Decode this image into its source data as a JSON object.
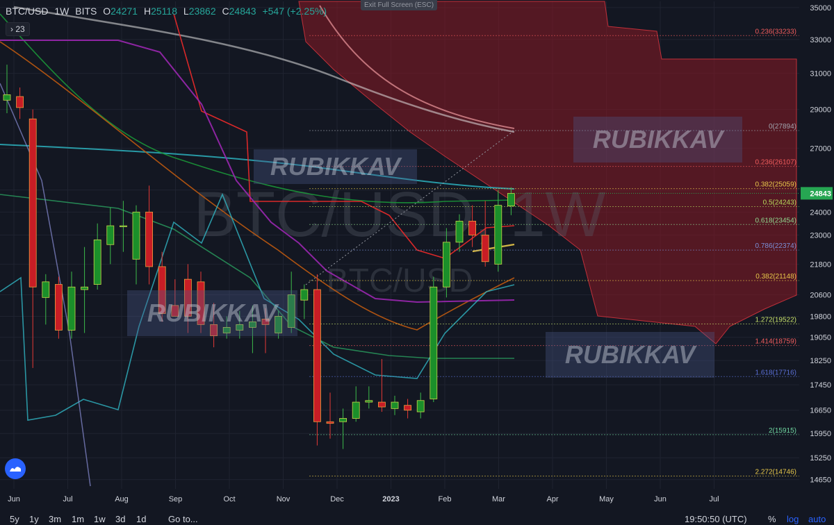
{
  "header": {
    "symbol": "BTC/USD",
    "interval": "1W",
    "exchange": "BITS",
    "open_label": "O",
    "open": "24271",
    "high_label": "H",
    "high": "25118",
    "low_label": "L",
    "low": "23862",
    "close_label": "C",
    "close": "24843",
    "change": "+547 (+2.25%)"
  },
  "indicator_toggle": "› 23",
  "exit_fullscreen": "Exit Full Screen (ESC)",
  "watermark": {
    "main": "BTC/USD, 1W",
    "sub": "BTC/USD"
  },
  "brand_watermark": "RUBIKKAV",
  "colors": {
    "up": "#26a69a",
    "down": "#ef5350",
    "green_body": "#1b8f2a",
    "red_body": "#c81d25",
    "cloud": "#8b1a24",
    "current_price": "#26a652"
  },
  "bottom_bar": {
    "timeframes": [
      "5y",
      "1y",
      "3m",
      "1m",
      "1w",
      "3d",
      "1d"
    ],
    "goto": "Go to...",
    "time": "19:50:50 (UTC)",
    "percent": "%",
    "log": "log",
    "auto": "auto"
  },
  "chart_data": {
    "type": "candlestick",
    "y_axis": {
      "ticks": [
        35000,
        33000,
        31000,
        29000,
        27000,
        25000,
        24000,
        23000,
        21800,
        20600,
        19800,
        19050,
        18250,
        17450,
        16650,
        15950,
        15250,
        14650
      ],
      "ylim": [
        14400,
        35400
      ],
      "scale": "log"
    },
    "x_axis": {
      "ticks": [
        "Jun",
        "Jul",
        "Aug",
        "Sep",
        "Oct",
        "Nov",
        "Dec",
        "2023",
        "Feb",
        "Mar",
        "Apr",
        "May",
        "Jun",
        "Jul"
      ]
    },
    "current_price": 24843,
    "fib_levels": [
      {
        "label": "0.236(33233)",
        "value": 33233
      },
      {
        "label": "0(27894)",
        "value": 27894
      },
      {
        "label": "0.236(26107)",
        "value": 26107
      },
      {
        "label": "0.382(25059)",
        "value": 25059
      },
      {
        "label": "0.5(24243)",
        "value": 24243
      },
      {
        "label": "0.618(23454)",
        "value": 23454
      },
      {
        "label": "0.786(22374)",
        "value": 22374
      },
      {
        "label": "0.382(21148)",
        "value": 21148
      },
      {
        "label": "1.272(19522)",
        "value": 19522
      },
      {
        "label": "1.414(18759)",
        "value": 18759
      },
      {
        "label": "1.618(17716)",
        "value": 17716
      },
      {
        "label": "2(15915)",
        "value": 15915
      },
      {
        "label": "2.272(14746)",
        "value": 14746
      }
    ],
    "candles": [
      {
        "x": 0.4,
        "o": 29500,
        "h": 31500,
        "l": 28800,
        "c": 29800
      },
      {
        "x": 1.4,
        "o": 29700,
        "h": 30200,
        "l": 28500,
        "c": 29100
      },
      {
        "x": 2.4,
        "o": 28500,
        "h": 29000,
        "l": 18000,
        "c": 20900
      },
      {
        "x": 3.4,
        "o": 20500,
        "h": 21400,
        "l": 19500,
        "c": 21100
      },
      {
        "x": 4.4,
        "o": 21000,
        "h": 21300,
        "l": 19000,
        "c": 19300
      },
      {
        "x": 5.4,
        "o": 19300,
        "h": 21500,
        "l": 19000,
        "c": 20900
      },
      {
        "x": 6.4,
        "o": 20800,
        "h": 22500,
        "l": 19200,
        "c": 20900
      },
      {
        "x": 7.4,
        "o": 21000,
        "h": 23500,
        "l": 20800,
        "c": 22800
      },
      {
        "x": 8.4,
        "o": 22600,
        "h": 24200,
        "l": 21800,
        "c": 23400
      },
      {
        "x": 9.4,
        "o": 23400,
        "h": 24500,
        "l": 22300,
        "c": 23400
      },
      {
        "x": 10.4,
        "o": 22000,
        "h": 24300,
        "l": 21000,
        "c": 24000
      },
      {
        "x": 11.4,
        "o": 24000,
        "h": 25200,
        "l": 21000,
        "c": 21700
      },
      {
        "x": 12.4,
        "o": 21700,
        "h": 22300,
        "l": 19600,
        "c": 19900
      },
      {
        "x": 13.4,
        "o": 20200,
        "h": 21200,
        "l": 19900,
        "c": 19800
      },
      {
        "x": 14.4,
        "o": 21200,
        "h": 21800,
        "l": 19200,
        "c": 19800
      },
      {
        "x": 15.4,
        "o": 21100,
        "h": 21500,
        "l": 19200,
        "c": 19500
      },
      {
        "x": 16.4,
        "o": 19500,
        "h": 20300,
        "l": 18700,
        "c": 19100
      },
      {
        "x": 17.4,
        "o": 19200,
        "h": 19800,
        "l": 19000,
        "c": 19400
      },
      {
        "x": 18.4,
        "o": 19300,
        "h": 20000,
        "l": 19000,
        "c": 19500
      },
      {
        "x": 19.4,
        "o": 19400,
        "h": 20200,
        "l": 18500,
        "c": 19600
      },
      {
        "x": 20.4,
        "o": 19700,
        "h": 20100,
        "l": 18500,
        "c": 19500
      },
      {
        "x": 21.4,
        "o": 19200,
        "h": 20000,
        "l": 19000,
        "c": 19800
      },
      {
        "x": 22.4,
        "o": 19400,
        "h": 21500,
        "l": 19200,
        "c": 20600
      },
      {
        "x": 23.4,
        "o": 20400,
        "h": 21000,
        "l": 19700,
        "c": 20800
      },
      {
        "x": 24.4,
        "o": 20800,
        "h": 21400,
        "l": 15600,
        "c": 16300
      },
      {
        "x": 25.4,
        "o": 16300,
        "h": 17200,
        "l": 15800,
        "c": 16250
      },
      {
        "x": 26.4,
        "o": 16300,
        "h": 16700,
        "l": 15500,
        "c": 16400
      },
      {
        "x": 27.4,
        "o": 16400,
        "h": 17400,
        "l": 16300,
        "c": 16900
      },
      {
        "x": 28.4,
        "o": 16900,
        "h": 17400,
        "l": 16700,
        "c": 16950
      },
      {
        "x": 29.4,
        "o": 16900,
        "h": 18300,
        "l": 16600,
        "c": 16750
      },
      {
        "x": 30.4,
        "o": 16700,
        "h": 17100,
        "l": 16500,
        "c": 16900
      },
      {
        "x": 31.4,
        "o": 16800,
        "h": 17000,
        "l": 16400,
        "c": 16650
      },
      {
        "x": 32.4,
        "o": 16600,
        "h": 17200,
        "l": 16400,
        "c": 16950
      },
      {
        "x": 33.4,
        "o": 17000,
        "h": 21300,
        "l": 16900,
        "c": 20900
      },
      {
        "x": 34.4,
        "o": 20900,
        "h": 23300,
        "l": 20500,
        "c": 22700
      },
      {
        "x": 35.4,
        "o": 22700,
        "h": 23900,
        "l": 22300,
        "c": 23600
      },
      {
        "x": 36.4,
        "o": 23600,
        "h": 24300,
        "l": 22500,
        "c": 23000
      },
      {
        "x": 37.4,
        "o": 23000,
        "h": 24500,
        "l": 21700,
        "c": 21900
      },
      {
        "x": 38.4,
        "o": 21800,
        "h": 25000,
        "l": 21500,
        "c": 24300
      },
      {
        "x": 39.4,
        "o": 24271,
        "h": 25118,
        "l": 23862,
        "c": 24843
      }
    ]
  }
}
